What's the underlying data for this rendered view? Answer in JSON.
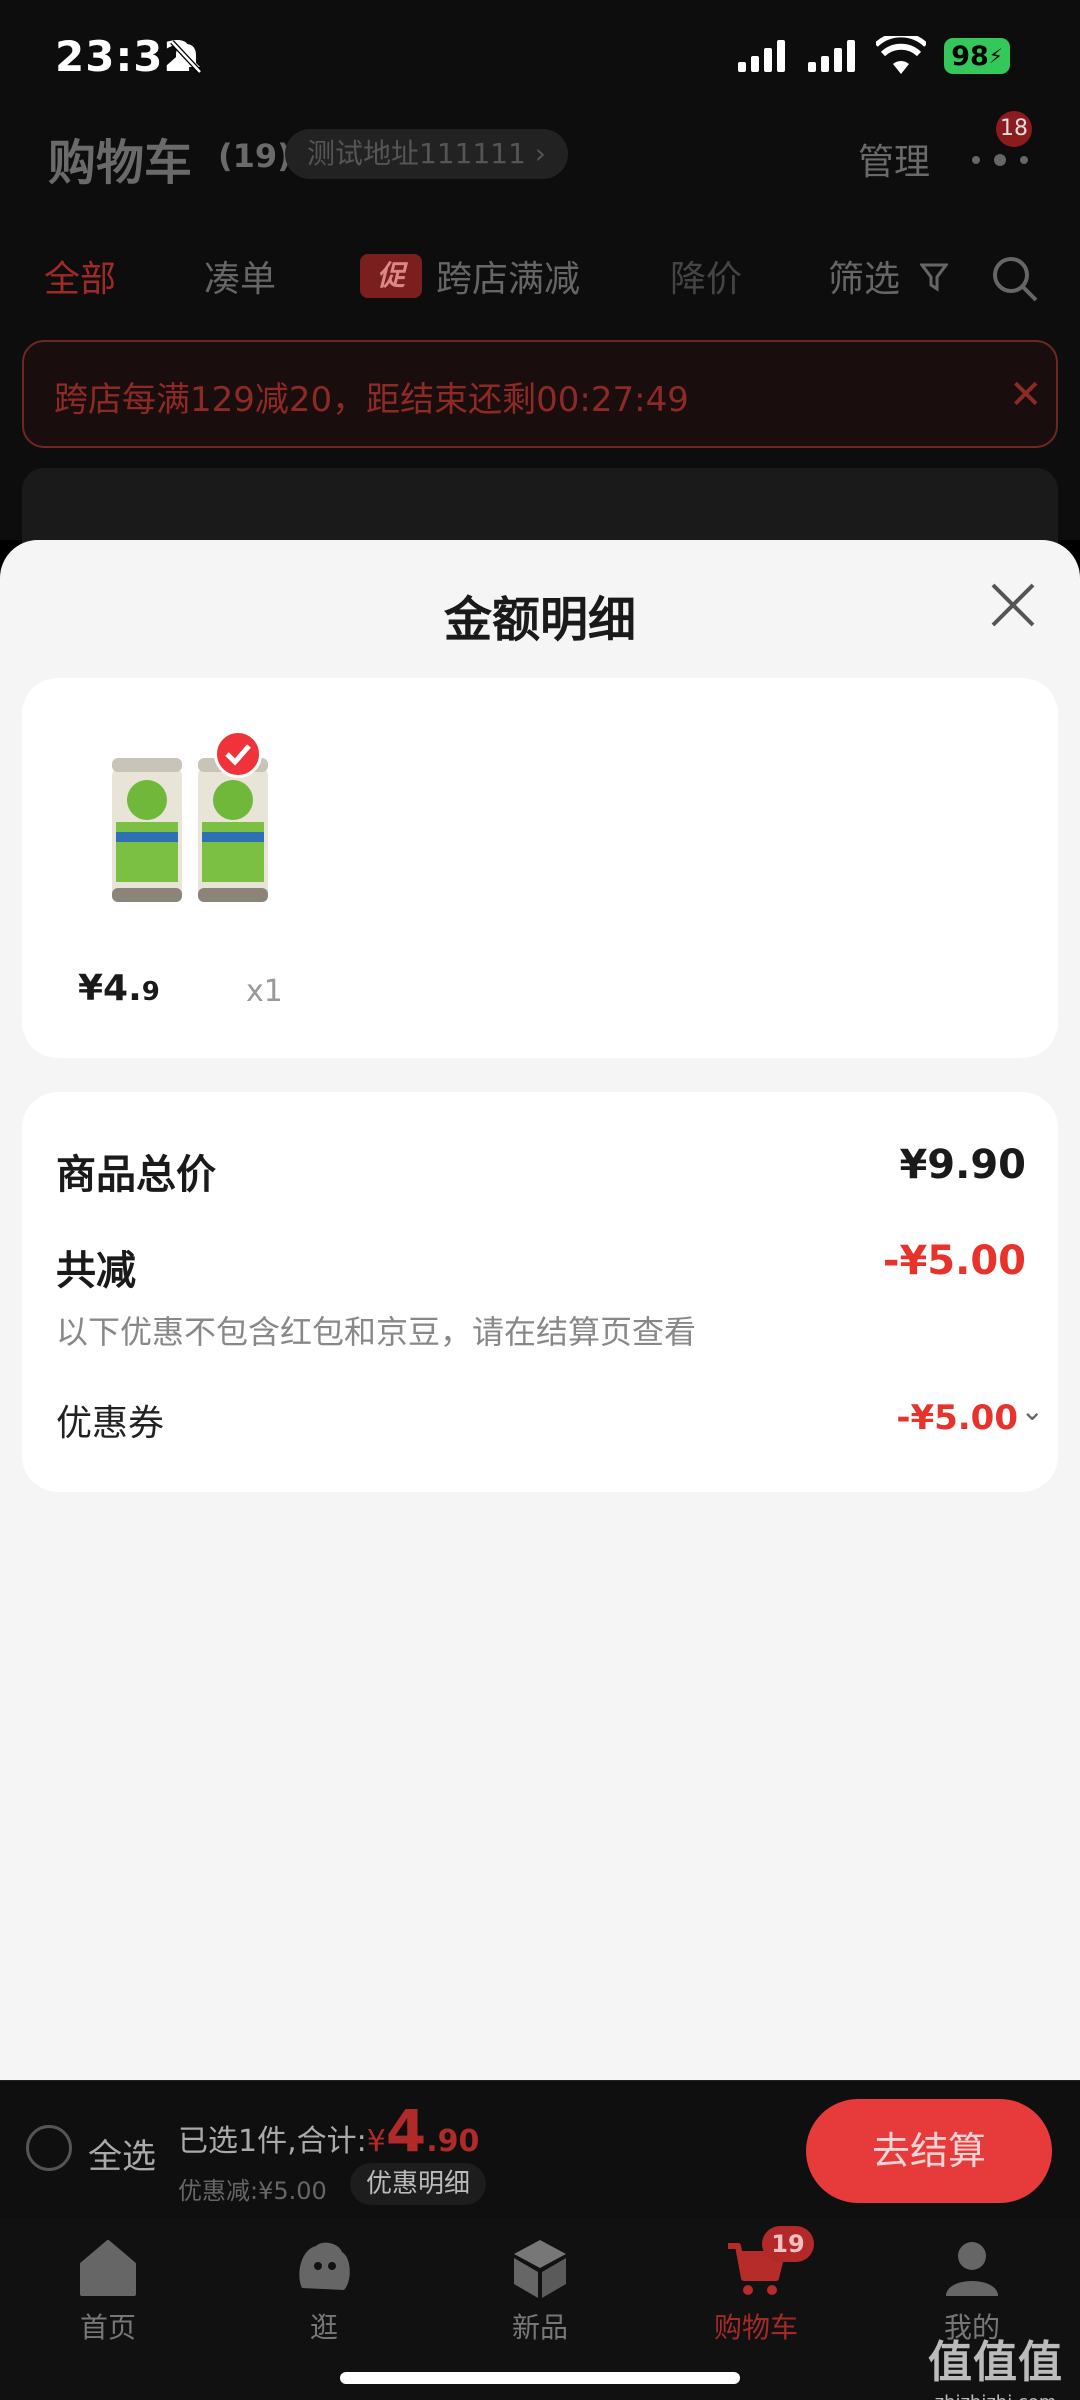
{
  "status_bar": {
    "time": "23:32",
    "battery": "98"
  },
  "header": {
    "title": "购物车",
    "count": "(19)",
    "address": "测试地址111111",
    "manage_label": "管理",
    "more_badge": "18"
  },
  "tabs": {
    "all": "全部",
    "bundle": "凑单",
    "promo_tag": "促",
    "cross_store": "跨店满减",
    "price_drop": "降价",
    "filter": "筛选"
  },
  "banner": {
    "text": "跨店每满129减20，距结束还剩00:27:49"
  },
  "sheet": {
    "title": "金额明细",
    "products": [
      {
        "price_int": "¥4.",
        "price_dec": "9",
        "quantity": "x1"
      }
    ],
    "summary": {
      "total_label": "商品总价",
      "total_value": "¥9.90",
      "discount_label": "共减",
      "discount_value": "-¥5.00",
      "note": "以下优惠不包含红包和京豆，请在结算页查看",
      "coupon_label": "优惠券",
      "coupon_value": "-¥5.00"
    }
  },
  "bottom_bar": {
    "select_all": "全选",
    "selected_text": "已选1件,合计:",
    "total_symbol": "¥",
    "total_int": "4",
    "total_dec": ".90",
    "discount_text": "优惠减:¥5.00",
    "detail_chip": "优惠明细",
    "checkout": "去结算"
  },
  "tabbar": {
    "items": [
      {
        "label": "首页",
        "icon": "home-icon"
      },
      {
        "label": "逛",
        "icon": "browse-icon"
      },
      {
        "label": "新品",
        "icon": "cube-icon"
      },
      {
        "label": "购物车",
        "icon": "cart-icon"
      },
      {
        "label": "我的",
        "icon": "profile-icon"
      }
    ],
    "cart_badge": "19"
  },
  "watermark": {
    "big": "值值值",
    "small": "zhizhizhi.com"
  },
  "colors": {
    "accent": "#e8332c",
    "checkout": "#e73a3a"
  }
}
